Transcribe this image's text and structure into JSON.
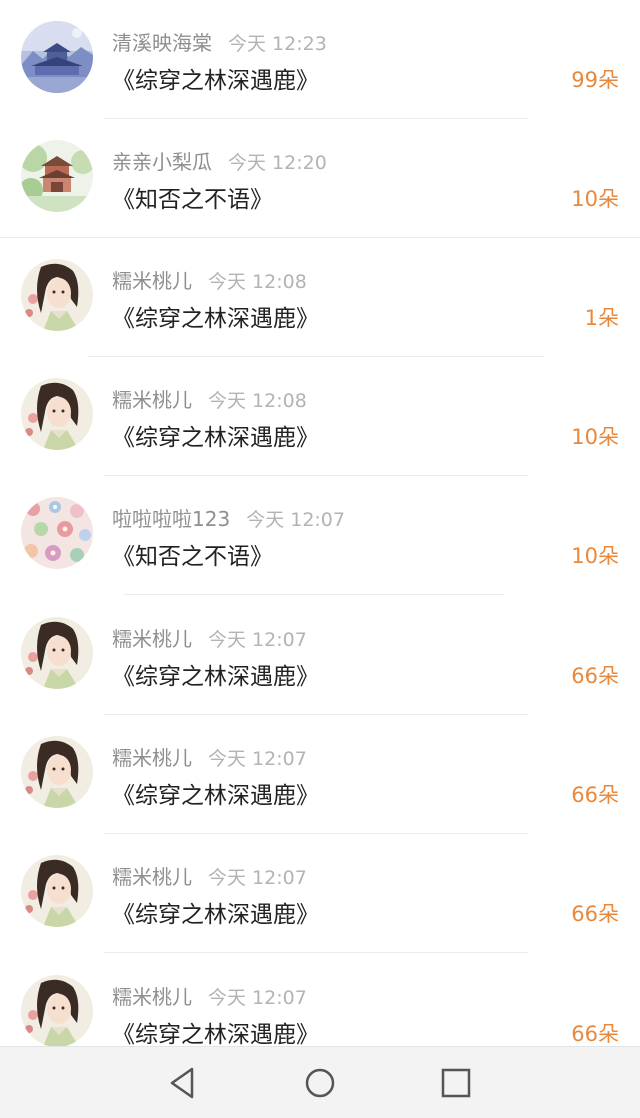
{
  "rows": [
    {
      "user": "清溪映海棠",
      "time": "今天 12:23",
      "book": "《综穿之林深遇鹿》",
      "amount": "99朵",
      "avatar_icon": "palace-painting-avatar"
    },
    {
      "user": "亲亲小梨瓜",
      "time": "今天 12:20",
      "book": "《知否之不语》",
      "amount": "10朵",
      "avatar_icon": "pavilion-painting-avatar"
    },
    {
      "user": "糯米桃儿",
      "time": "今天 12:08",
      "book": "《综穿之林深遇鹿》",
      "amount": "1朵",
      "avatar_icon": "anime-girl-avatar"
    },
    {
      "user": "糯米桃儿",
      "time": "今天 12:08",
      "book": "《综穿之林深遇鹿》",
      "amount": "10朵",
      "avatar_icon": "anime-girl-avatar"
    },
    {
      "user": "啦啦啦啦123",
      "time": "今天 12:07",
      "book": "《知否之不语》",
      "amount": "10朵",
      "avatar_icon": "floral-pattern-avatar"
    },
    {
      "user": "糯米桃儿",
      "time": "今天 12:07",
      "book": "《综穿之林深遇鹿》",
      "amount": "66朵",
      "avatar_icon": "anime-girl-avatar"
    },
    {
      "user": "糯米桃儿",
      "time": "今天 12:07",
      "book": "《综穿之林深遇鹿》",
      "amount": "66朵",
      "avatar_icon": "anime-girl-avatar"
    },
    {
      "user": "糯米桃儿",
      "time": "今天 12:07",
      "book": "《综穿之林深遇鹿》",
      "amount": "66朵",
      "avatar_icon": "anime-girl-avatar"
    },
    {
      "user": "糯米桃儿",
      "time": "今天 12:07",
      "book": "《综穿之林深遇鹿》",
      "amount": "66朵",
      "avatar_icon": "anime-girl-avatar"
    }
  ],
  "navbar": {
    "back_icon": "back-triangle-icon",
    "home_icon": "home-circle-icon",
    "recents_icon": "recents-square-icon"
  },
  "colors": {
    "amount": "#e8883c",
    "username": "#8f8f8f",
    "time": "#b3b3b3",
    "title": "#222222"
  }
}
